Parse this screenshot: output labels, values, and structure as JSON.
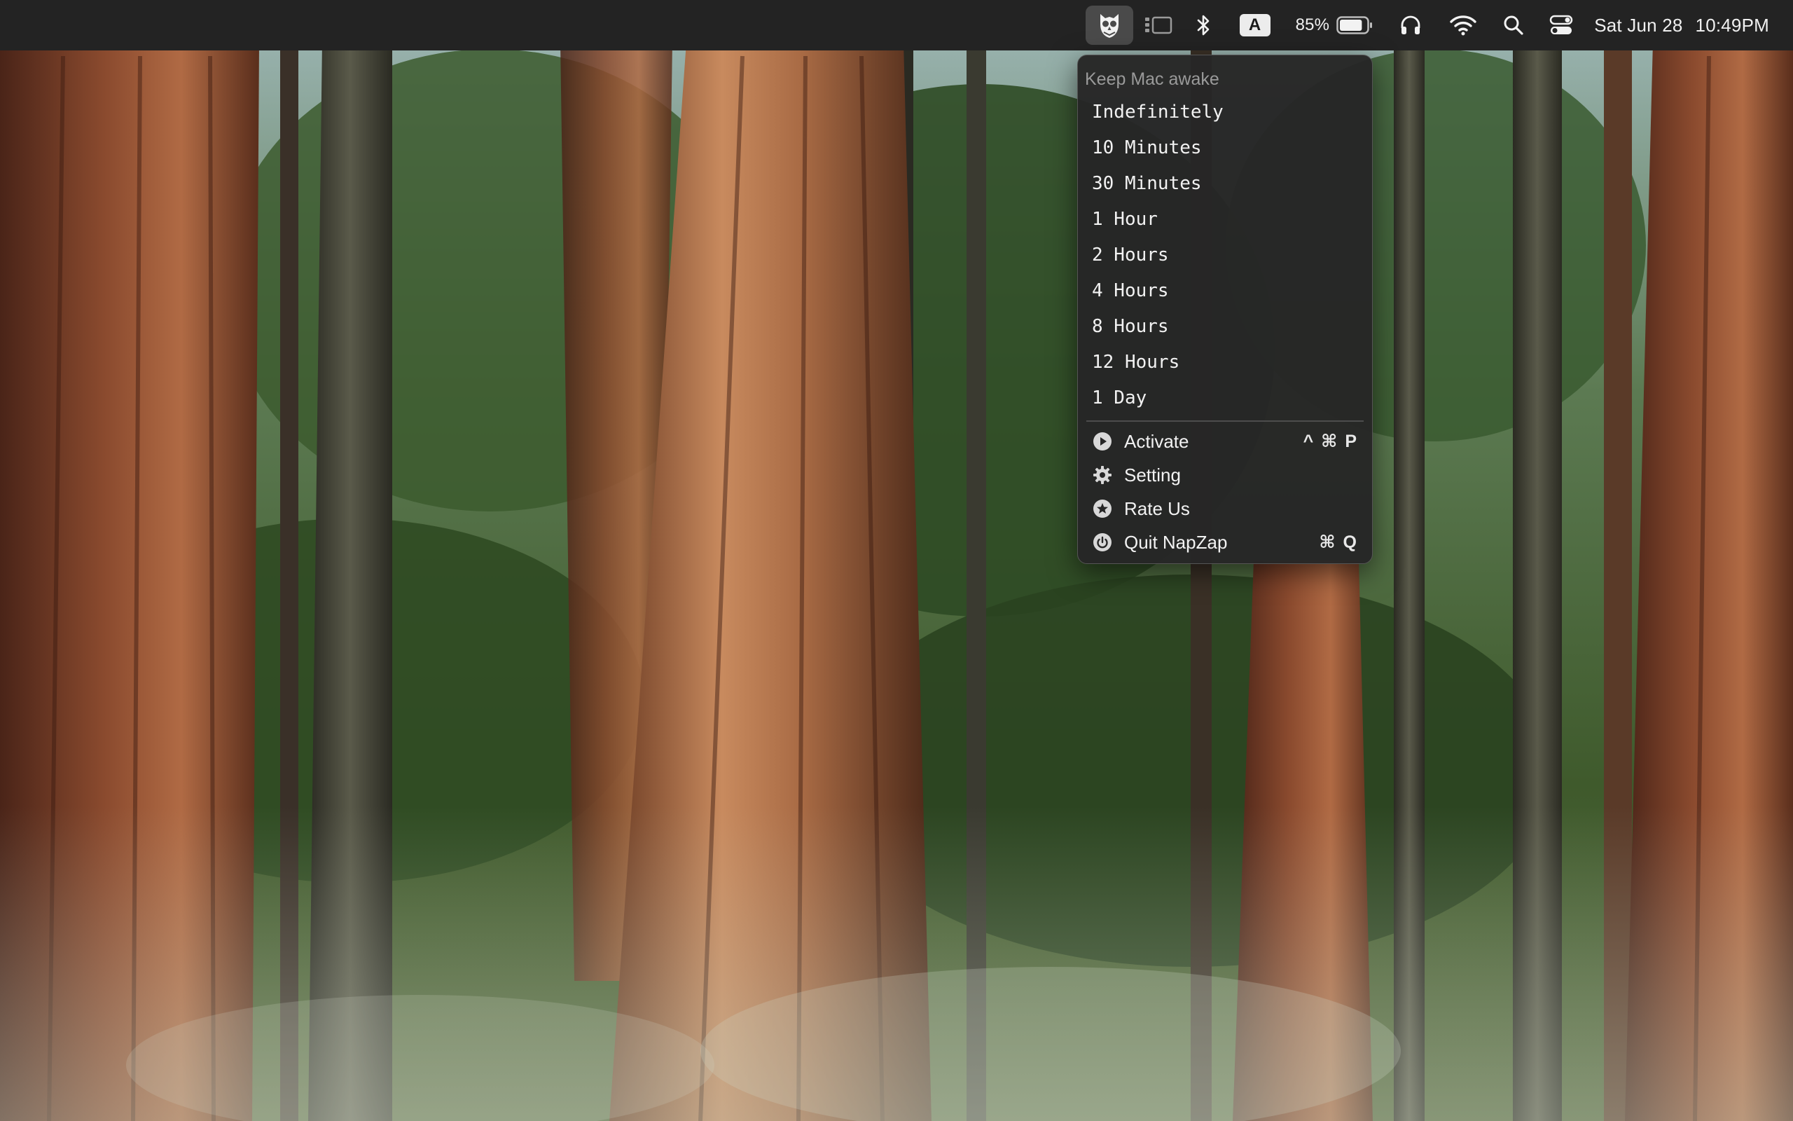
{
  "menubar": {
    "app_icon": "napzap-owl-icon",
    "stage_manager_icon": "stage-manager-icon",
    "bluetooth_icon": "bluetooth-icon",
    "input_source": "A",
    "battery_percent": "85%",
    "battery_level": 0.85,
    "headphones_icon": "headphones-icon",
    "wifi_icon": "wifi-icon",
    "search_icon": "search-icon",
    "control_center_icon": "control-center-icon",
    "date": "Sat Jun 28",
    "time": "10:49PM"
  },
  "menu": {
    "header": "Keep Mac awake",
    "durations": [
      "Indefinitely",
      "10 Minutes",
      "30 Minutes",
      "1 Hour",
      "2 Hours",
      "4 Hours",
      "8 Hours",
      "12 Hours",
      "1 Day"
    ],
    "actions": [
      {
        "label": "Activate",
        "icon": "play-circle-icon",
        "shortcut": "^ ⌘ P"
      },
      {
        "label": "Setting",
        "icon": "gear-icon",
        "shortcut": ""
      },
      {
        "label": "Rate Us",
        "icon": "star-circle-icon",
        "shortcut": ""
      },
      {
        "label": "Quit NapZap",
        "icon": "power-icon",
        "shortcut": "⌘ Q"
      }
    ]
  },
  "colors": {
    "menubar_bg": "#232323",
    "menu_bg": "#262626",
    "menu_text": "#f2f2f2",
    "menu_header_text": "#9a9a9a"
  }
}
